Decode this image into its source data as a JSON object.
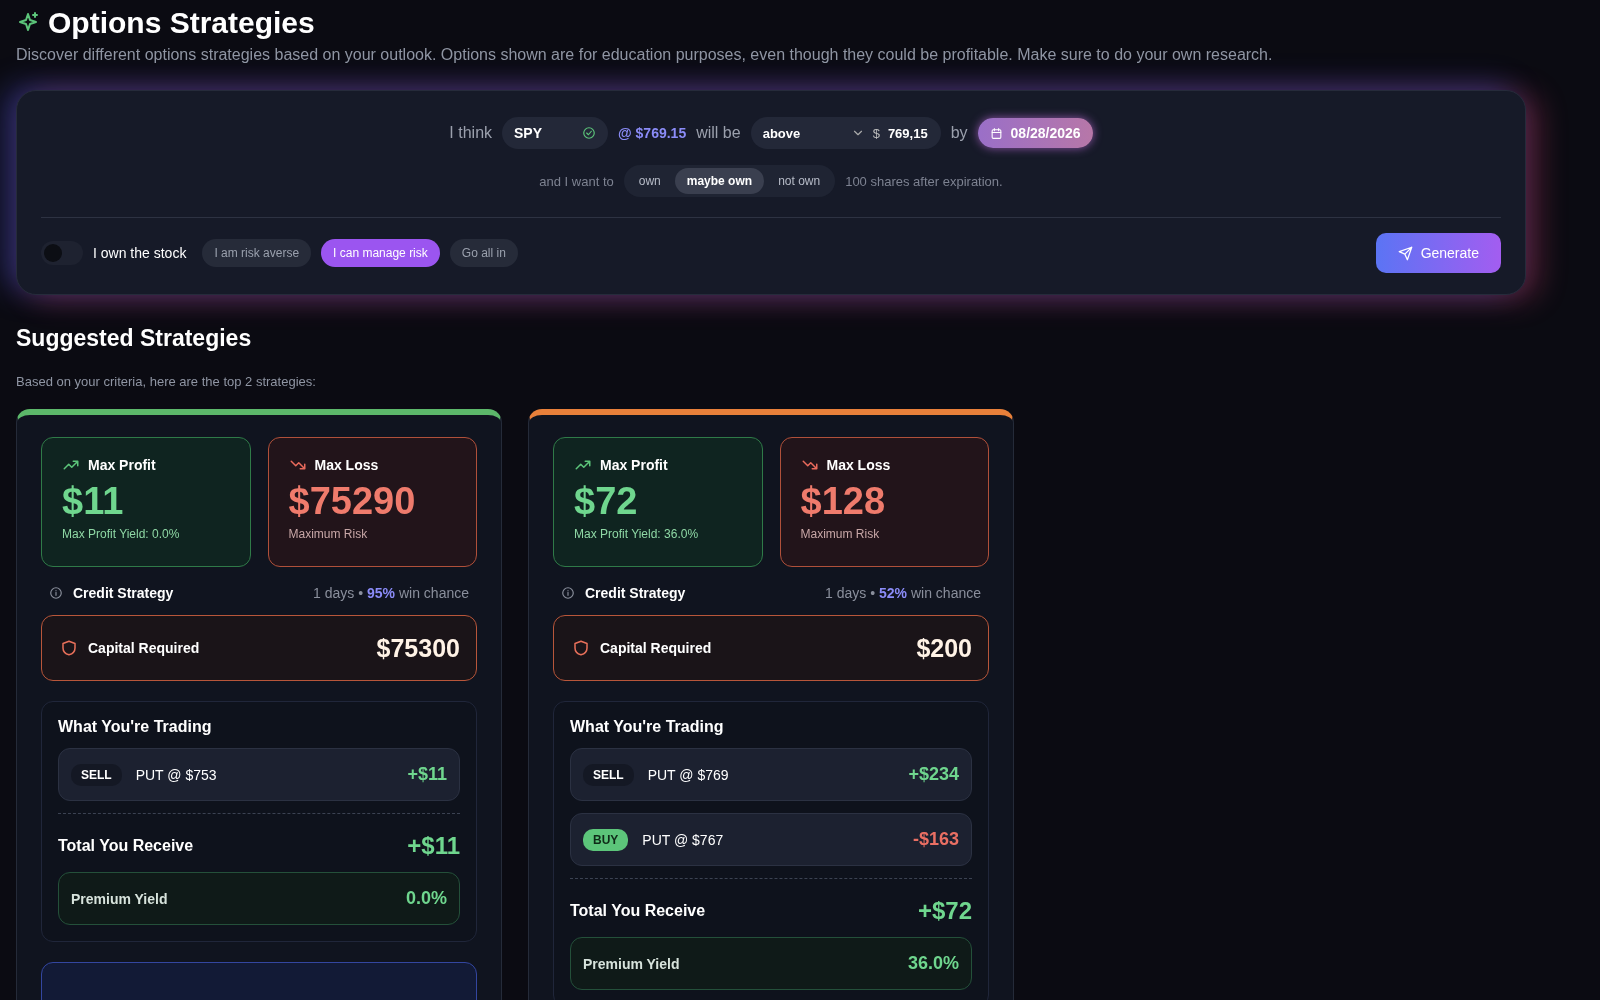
{
  "header": {
    "title": "Options Strategies",
    "subtitle": "Discover different options strategies based on your outlook. Options shown are for education purposes, even though they could be profitable. Make sure to do your own research."
  },
  "outlook": {
    "prefix": "I think",
    "ticker": "SPY",
    "price": "@ $769.15",
    "will_be": "will be",
    "direction": "above",
    "currency": "$",
    "target": "769,15",
    "by": "by",
    "date": "08/28/2026",
    "want_prefix": "and I want to",
    "ownership": [
      {
        "label": "own",
        "selected": false
      },
      {
        "label": "maybe own",
        "selected": true
      },
      {
        "label": "not own",
        "selected": false
      }
    ],
    "want_suffix": "100 shares after expiration.",
    "own_stock": {
      "label": "I own the stock",
      "on": false
    },
    "risk": [
      {
        "label": "I am risk averse",
        "selected": false
      },
      {
        "label": "I can manage risk",
        "selected": true
      },
      {
        "label": "Go all in",
        "selected": false
      }
    ],
    "generate": "Generate"
  },
  "suggestions": {
    "title": "Suggested Strategies",
    "subtitle": "Based on your criteria, here are the top 2 strategies:",
    "cards": [
      {
        "color": "#5cb86a",
        "profit_label": "Max Profit",
        "profit": "$11",
        "profit_note": "Max Profit Yield: 0.0%",
        "loss_label": "Max Loss",
        "loss": "$75290",
        "loss_note": "Maximum Risk",
        "strategy": "Credit Strategy",
        "days": "1 days",
        "separator": "•",
        "win": "95%",
        "win_suffix": "win chance",
        "capital_label": "Capital Required",
        "capital": "$75300",
        "trading_title": "What You're Trading",
        "legs": [
          {
            "kind": "sell",
            "action": "SELL",
            "contract": "PUT @ $753",
            "amount": "+$11"
          }
        ],
        "total_label": "Total You Receive",
        "total": "+$11",
        "yield_label": "Premium Yield",
        "yield": "0.0%"
      },
      {
        "color": "#e8803a",
        "profit_label": "Max Profit",
        "profit": "$72",
        "profit_note": "Max Profit Yield: 36.0%",
        "loss_label": "Max Loss",
        "loss": "$128",
        "loss_note": "Maximum Risk",
        "strategy": "Credit Strategy",
        "days": "1 days",
        "separator": "•",
        "win": "52%",
        "win_suffix": "win chance",
        "capital_label": "Capital Required",
        "capital": "$200",
        "trading_title": "What You're Trading",
        "legs": [
          {
            "kind": "sell",
            "action": "SELL",
            "contract": "PUT @ $769",
            "amount": "+$234"
          },
          {
            "kind": "buy",
            "action": "BUY",
            "contract": "PUT @ $767",
            "amount": "-$163"
          }
        ],
        "total_label": "Total You Receive",
        "total": "+$72",
        "yield_label": "Premium Yield",
        "yield": "36.0%"
      }
    ]
  }
}
